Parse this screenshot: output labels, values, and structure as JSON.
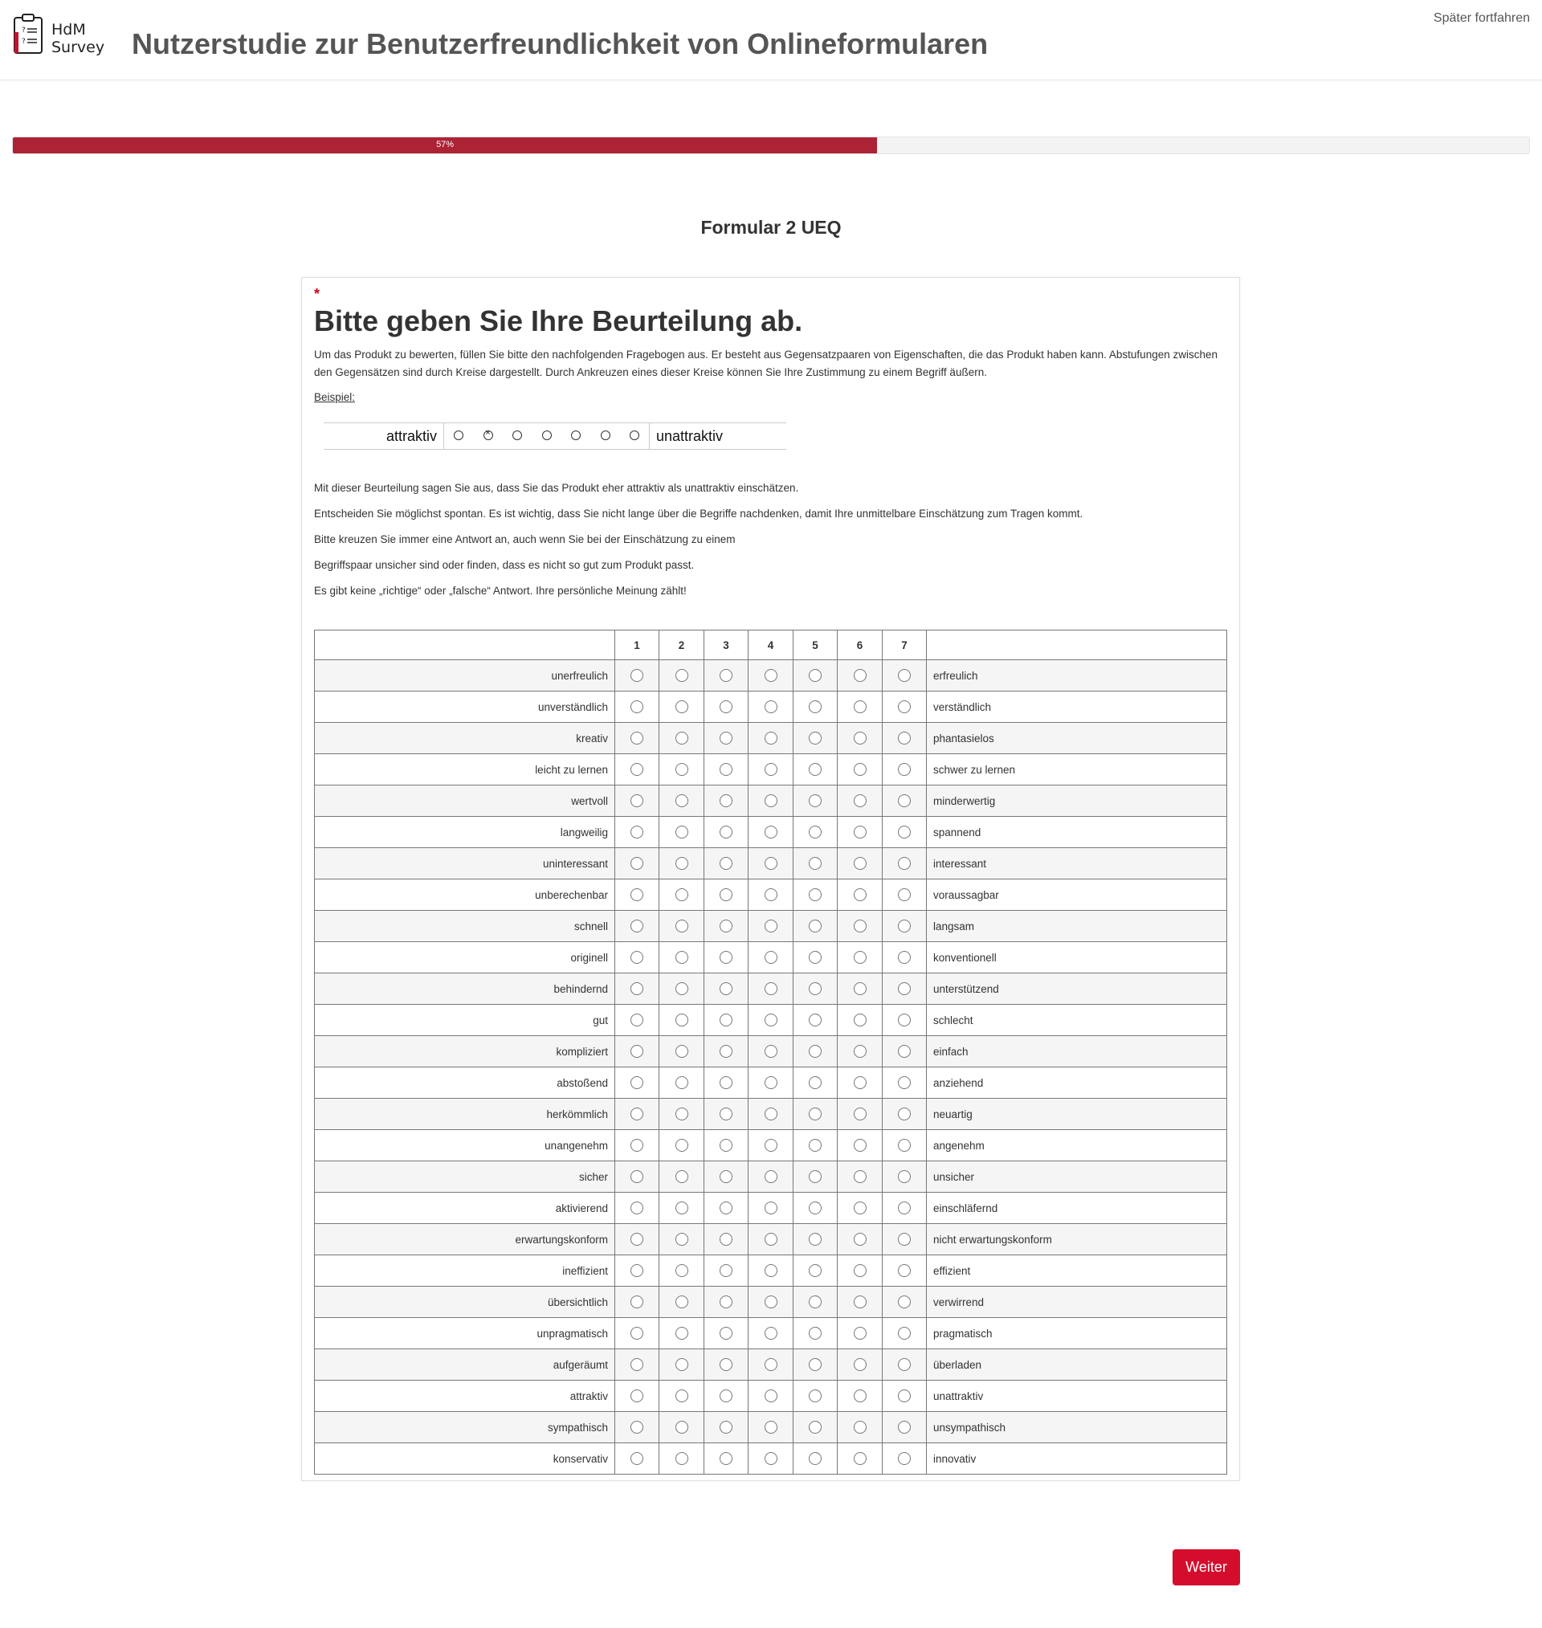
{
  "header": {
    "logo_text_line1": "HdM",
    "logo_text_line2": "Survey",
    "title": "Nutzerstudie zur Benutzerfreundlichkeit von Onlineformularen",
    "later_link": "Später fortfahren"
  },
  "progress": {
    "label": "57%",
    "value": 0.57
  },
  "page_heading": "Formular 2 UEQ",
  "question": {
    "required_marker": "*",
    "title": "Bitte geben Sie Ihre Beurteilung ab.",
    "intro": "Um das Produkt zu bewerten, füllen Sie bitte den nachfolgenden Fragebogen aus. Er besteht aus Gegensatzpaaren von Eigenschaften, die das Produkt haben kann. Abstufungen zwischen den Gegensätzen sind durch Kreise dargestellt. Durch Ankreuzen eines dieser Kreise können Sie Ihre Zustimmung zu einem Begriff äußern.",
    "example_label": "Beispiel:",
    "example": {
      "left": "attraktiv",
      "right": "unattraktiv",
      "selected_index": 1,
      "option_count": 7
    },
    "info": [
      "Mit dieser Beurteilung sagen Sie aus, dass Sie das Produkt eher attraktiv als unattraktiv einschätzen.",
      "Entscheiden Sie möglichst spontan. Es ist wichtig, dass Sie nicht lange über die Begriffe nachdenken, damit Ihre unmittelbare Einschätzung zum Tragen kommt.",
      "Bitte kreuzen Sie immer eine Antwort an, auch wenn Sie bei der Einschätzung zu einem",
      "Begriffspaar unsicher sind oder finden, dass es nicht so gut zum Produkt passt.",
      "Es gibt keine „richtige“ oder „falsche“ Antwort. Ihre persönliche Meinung zählt!"
    ]
  },
  "table": {
    "columns": [
      "1",
      "2",
      "3",
      "4",
      "5",
      "6",
      "7"
    ],
    "rows": [
      {
        "left": "unerfreulich",
        "right": "erfreulich"
      },
      {
        "left": "unverständlich",
        "right": "verständlich"
      },
      {
        "left": "kreativ",
        "right": "phantasielos"
      },
      {
        "left": "leicht zu lernen",
        "right": "schwer zu lernen"
      },
      {
        "left": "wertvoll",
        "right": "minderwertig"
      },
      {
        "left": "langweilig",
        "right": "spannend"
      },
      {
        "left": "uninteressant",
        "right": "interessant"
      },
      {
        "left": "unberechenbar",
        "right": "voraussagbar"
      },
      {
        "left": "schnell",
        "right": "langsam"
      },
      {
        "left": "originell",
        "right": "konventionell"
      },
      {
        "left": "behindernd",
        "right": "unterstützend"
      },
      {
        "left": "gut",
        "right": "schlecht"
      },
      {
        "left": "kompliziert",
        "right": "einfach"
      },
      {
        "left": "abstoßend",
        "right": "anziehend"
      },
      {
        "left": "herkömmlich",
        "right": "neuartig"
      },
      {
        "left": "unangenehm",
        "right": "angenehm"
      },
      {
        "left": "sicher",
        "right": "unsicher"
      },
      {
        "left": "aktivierend",
        "right": "einschläfernd"
      },
      {
        "left": "erwartungskonform",
        "right": "nicht erwartungskonform"
      },
      {
        "left": "ineffizient",
        "right": "effizient"
      },
      {
        "left": "übersichtlich",
        "right": "verwirrend"
      },
      {
        "left": "unpragmatisch",
        "right": "pragmatisch"
      },
      {
        "left": "aufgeräumt",
        "right": "überladen"
      },
      {
        "left": "attraktiv",
        "right": "unattraktiv"
      },
      {
        "left": "sympathisch",
        "right": "unsympathisch"
      },
      {
        "left": "konservativ",
        "right": "innovativ"
      }
    ]
  },
  "buttons": {
    "next": "Weiter"
  },
  "colors": {
    "brand_red": "#ac2335",
    "button_red": "#d50d2d"
  }
}
